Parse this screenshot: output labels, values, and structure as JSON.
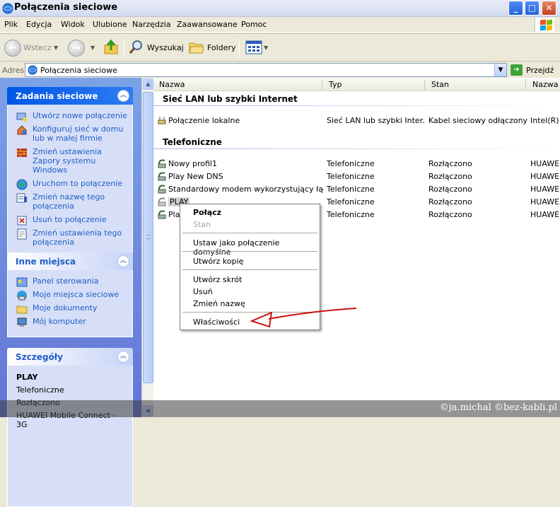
{
  "window": {
    "title": "Połączenia sieciowe"
  },
  "menu": [
    "Plik",
    "Edycja",
    "Widok",
    "Ulubione",
    "Narzędzia",
    "Zaawansowane",
    "Pomoc"
  ],
  "toolbar": {
    "back": "Wstecz",
    "search": "Wyszukaj",
    "folders": "Foldery"
  },
  "address": {
    "label": "Adres",
    "value": "Połączenia sieciowe",
    "go": "Przejdź"
  },
  "sidebar": {
    "network_tasks": {
      "title": "Zadania sieciowe",
      "items": [
        "Utwórz nowe połączenie",
        "Konfiguruj sieć w domu lub w małej firmie",
        "Zmień ustawienia Zapory systemu Windows",
        "Uruchom to połączenie",
        "Zmień nazwę tego połączenia",
        "Usuń to połączenie",
        "Zmień ustawienia tego połączenia"
      ]
    },
    "other_places": {
      "title": "Inne miejsca",
      "items": [
        "Panel sterowania",
        "Moje miejsca sieciowe",
        "Moje dokumenty",
        "Mój komputer"
      ]
    },
    "details": {
      "title": "Szczegóły",
      "name": "PLAY",
      "type": "Telefoniczne",
      "status": "Rozłączono",
      "device": "HUAWEI Mobile Connect - 3G"
    }
  },
  "columns": [
    "Nazwa",
    "Typ",
    "Stan",
    "Nazwa"
  ],
  "groups": {
    "lan": {
      "title": "Sieć LAN lub szybki Internet",
      "rows": [
        {
          "name": "Połączenie lokalne",
          "type": "Sieć LAN lub szybki Inter...",
          "status": "Kabel sieciowy odłączony",
          "device": "Intel(R)"
        }
      ]
    },
    "dialup": {
      "title": "Telefoniczne",
      "rows": [
        {
          "name": "Nowy profil1",
          "type": "Telefoniczne",
          "status": "Rozłączono",
          "device": "HUAWEI"
        },
        {
          "name": "Play New DNS",
          "type": "Telefoniczne",
          "status": "Rozłączono",
          "device": "HUAWEI"
        },
        {
          "name": "Standardowy modem wykorzystujący łącz...",
          "type": "Telefoniczne",
          "status": "Rozłączono",
          "device": "HUAWEI"
        },
        {
          "name": "PLAY",
          "type": "Telefoniczne",
          "status": "Rozłączono",
          "device": "HUAWEI"
        },
        {
          "name": "Pla",
          "type": "Telefoniczne",
          "status": "Rozłączono",
          "device": "HUAWEI"
        }
      ]
    }
  },
  "context_menu": {
    "connect": "Połącz",
    "status": "Stan",
    "set_default": "Ustaw jako połączenie domyślne",
    "copy": "Utwórz kopię",
    "shortcut": "Utwórz skrót",
    "delete": "Usuń",
    "rename": "Zmień nazwę",
    "properties": "Właściwości"
  },
  "watermark": "©ja.michal ©bez-kabli.pl",
  "colors": {
    "accent": "#215dc6",
    "annotation_arrow": "#cc1010",
    "sidebar_bg": "#6f8fe0"
  }
}
